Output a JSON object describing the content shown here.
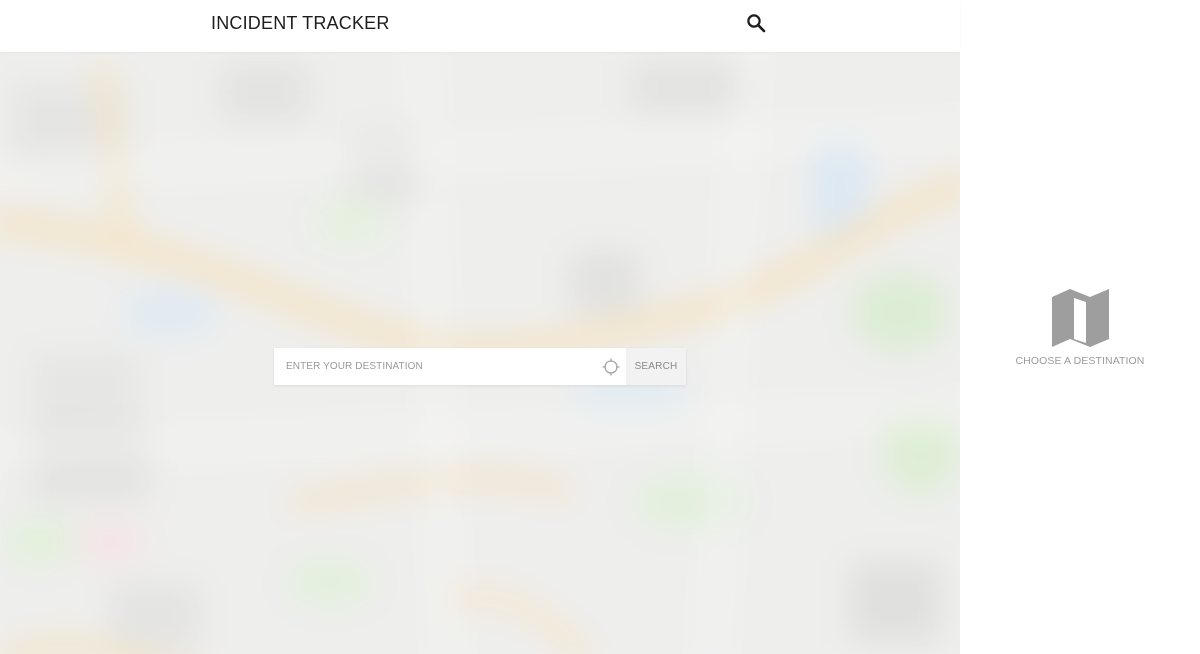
{
  "header": {
    "title": "INCIDENT TRACKER",
    "search_icon": "search-icon"
  },
  "destination_search": {
    "placeholder": "ENTER YOUR DESTINATION",
    "value": "",
    "locate_icon": "crosshair-icon",
    "search_label": "SEARCH"
  },
  "side_panel": {
    "icon": "map-icon",
    "empty_message": "CHOOSE A DESTINATION"
  },
  "colors": {
    "header_bg": "#ffffff",
    "title_text": "#1d1d1d",
    "panel_text": "#9b9b9b",
    "map_icon": "#9e9e9e",
    "search_button_bg": "#f2f2f2"
  }
}
